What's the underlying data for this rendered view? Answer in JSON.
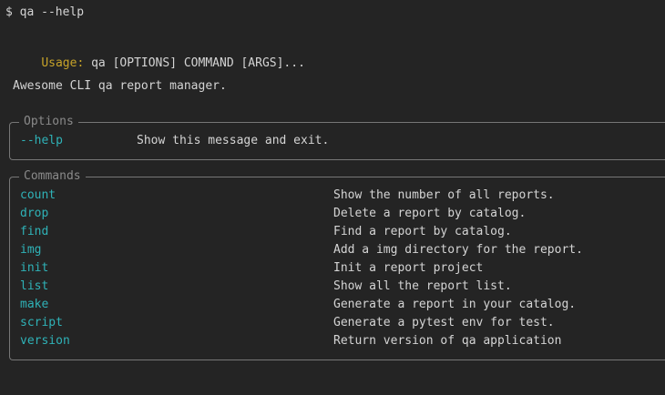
{
  "prompt": "$ qa --help",
  "usage": {
    "label": "Usage:",
    "text": " qa [OPTIONS] COMMAND [ARGS]..."
  },
  "description": "Awesome CLI qa report manager.",
  "options": {
    "title": "Options",
    "items": [
      {
        "name": "--help",
        "desc": "Show this message and exit."
      }
    ]
  },
  "commands": {
    "title": "Commands",
    "items": [
      {
        "name": "count",
        "desc": "Show the number of all reports."
      },
      {
        "name": "drop",
        "desc": "Delete a report by catalog."
      },
      {
        "name": "find",
        "desc": "Find a report by catalog."
      },
      {
        "name": "img",
        "desc": "Add a img directory for the report."
      },
      {
        "name": "init",
        "desc": "Init a report project"
      },
      {
        "name": "list",
        "desc": "Show all the report list."
      },
      {
        "name": "make",
        "desc": "Generate a report in your catalog."
      },
      {
        "name": "script",
        "desc": "Generate a pytest env for test."
      },
      {
        "name": "version",
        "desc": "Return version of qa application"
      }
    ]
  },
  "colors": {
    "accent_command": "#2fb2b7",
    "usage_label": "#c7a329",
    "background": "#242424"
  }
}
